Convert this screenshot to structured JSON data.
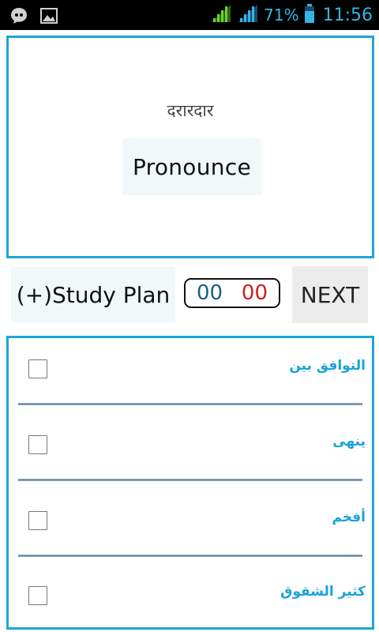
{
  "status_bar": {
    "battery": "71%",
    "time": "11:56",
    "icons": [
      "chat-notification-icon",
      "image-notification-icon",
      "wifi-icon",
      "signal-icon",
      "battery-icon"
    ]
  },
  "card": {
    "word": "दरारदार",
    "pronounce_label": "Pronounce"
  },
  "controls": {
    "study_plan_label": "(+)Study Plan",
    "timer_minutes": "00",
    "timer_seconds": "00",
    "next_label": "NEXT"
  },
  "options": [
    {
      "label": "التوافق بين",
      "checked": false
    },
    {
      "label": "ينهى",
      "checked": false
    },
    {
      "label": "أفخم",
      "checked": false
    },
    {
      "label": "كثير الشقوق",
      "checked": false
    }
  ],
  "colors": {
    "accent": "#1ea6d8",
    "status_text": "#33b5e5",
    "timer_minutes": "#1c5f86",
    "timer_seconds": "#cc2020",
    "button_bg": "#f1f8fa",
    "next_bg": "#ececec"
  }
}
